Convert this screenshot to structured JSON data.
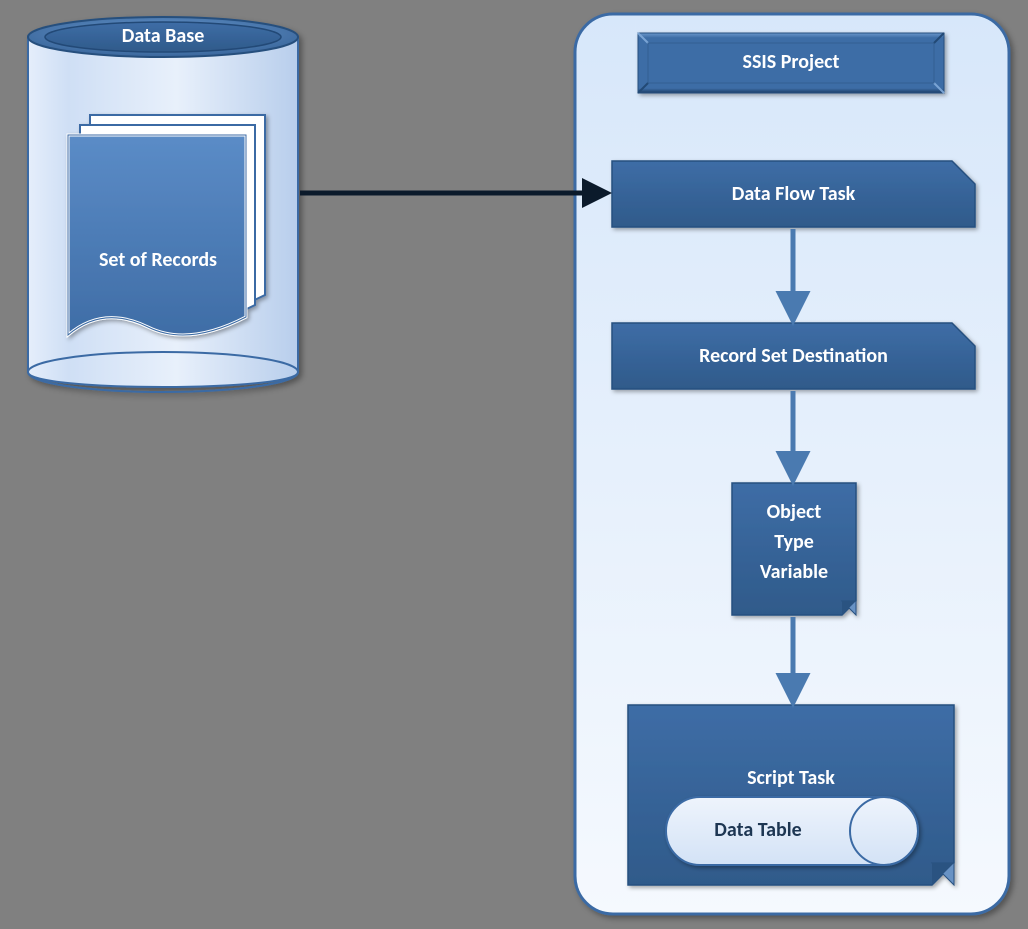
{
  "database": {
    "title": "Data Base",
    "records_label": "Set of Records"
  },
  "project": {
    "title": "SSIS Project",
    "data_flow_task": "Data Flow Task",
    "record_set_destination": "Record Set Destination",
    "object_variable_line1": "Object",
    "object_variable_line2": "Type",
    "object_variable_line3": "Variable",
    "script_task": "Script Task",
    "data_table": "Data Table"
  },
  "colors": {
    "light_panel_start": "#dbe8fb",
    "light_panel_end": "#f3f7fd",
    "medium_blue_start": "#4f81bd",
    "medium_blue_end": "#3e6da3",
    "dark_blue": "#2f5a8a",
    "stroke_blue": "#3b6ba4",
    "arrow_blue": "#4a7ab0"
  }
}
